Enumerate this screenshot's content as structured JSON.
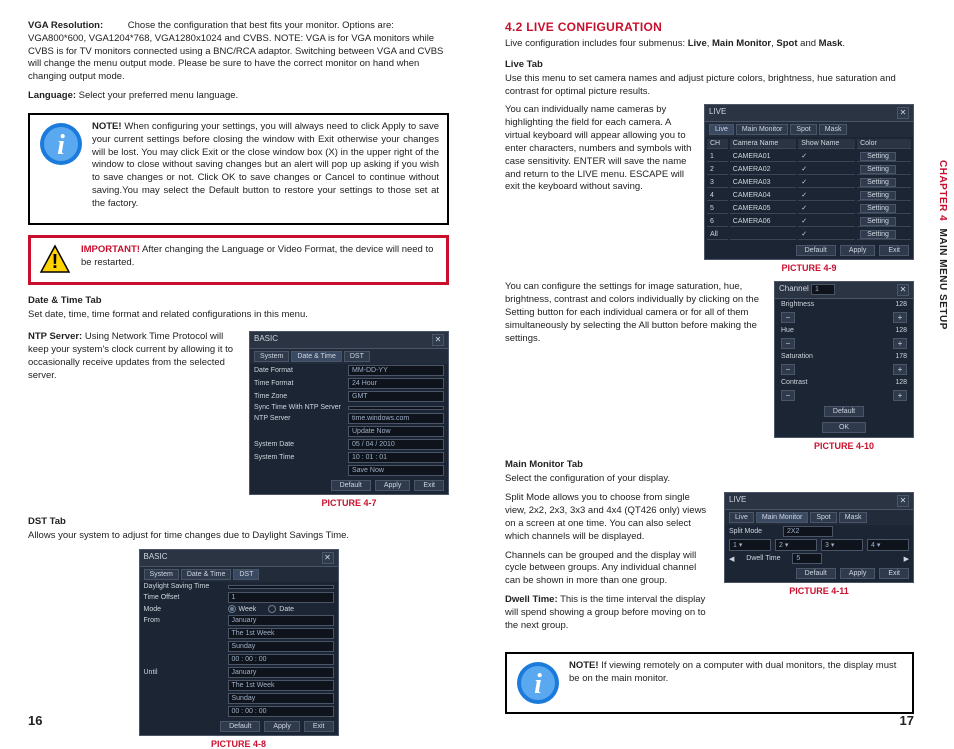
{
  "side": {
    "chapter": "CHAPTER 4",
    "title": "MAIN MENU SETUP"
  },
  "left": {
    "vga_head": "VGA Resolution:",
    "vga_body": " Chose the configuration that best fits your monitor. Options are: VGA800*600, VGA1204*768, VGA1280x1024 and CVBS. NOTE: VGA is for VGA monitors while CVBS is for TV monitors connected using a BNC/RCA adaptor. Switching between VGA and CVBS will change the menu output mode. Please be sure to have the correct monitor on hand when changing output mode.",
    "lang_head": "Language:",
    "lang_body": " Select your preferred menu language.",
    "note_head": "NOTE!",
    "note_body": " When configuring your settings, you will always need to click Apply to save your current settings before closing the window with Exit otherwise your changes will be lost. You may click Exit or the close window box (X) in the upper right of the window to close without saving changes but an alert will pop up asking if you wish to save changes or not. Click OK to save changes or Cancel to continue without saving.You may select the Default button to restore your settings to those set at the factory.",
    "important_head": "IMPORTANT!",
    "important_body": " After changing the Language or Video Format, the device will need to be restarted.",
    "dt_head": "Date & Time Tab",
    "dt_body": "Set date, time, time format and related configurations in this menu.",
    "ntp_head": "NTP Server:",
    "ntp_body": " Using Network Time Protocol will keep your system's clock current by allowing it to occasionally receive updates from the selected server.",
    "dst_head": "DST Tab",
    "dst_body": "Allows your system to adjust for time changes due to Daylight Savings Time.",
    "pic7": "PICTURE 4-7",
    "pic8": "PICTURE 4-8",
    "pagenum": "16",
    "ui47": {
      "title": "BASIC",
      "tab1": "System",
      "tab2": "Date & Time",
      "tab3": "DST",
      "rows": [
        [
          "Date Format",
          "MM-DD-YY"
        ],
        [
          "Time Format",
          "24 Hour"
        ],
        [
          "Time Zone",
          "GMT"
        ],
        [
          "Sync Time With NTP Server",
          ""
        ],
        [
          "NTP Server",
          "time.windows.com"
        ],
        [
          "",
          "Update Now"
        ],
        [
          "System Date",
          "05 / 04 / 2010"
        ],
        [
          "System Time",
          "10 : 01 : 01"
        ],
        [
          "",
          "Save Now"
        ]
      ],
      "btns": [
        "Default",
        "Apply",
        "Exit"
      ]
    },
    "ui48": {
      "title": "BASIC",
      "tab1": "System",
      "tab2": "Date & Time",
      "tab3": "DST",
      "rows": [
        [
          "Daylight Saving Time",
          ""
        ],
        [
          "Time Offset",
          "1"
        ],
        [
          "Mode",
          "Week",
          "Date"
        ],
        [
          "From",
          "January"
        ],
        [
          "",
          "The 1st Week"
        ],
        [
          "",
          "Sunday"
        ],
        [
          "",
          "00 : 00 : 00"
        ],
        [
          "Until",
          "January"
        ],
        [
          "",
          "The 1st Week"
        ],
        [
          "",
          "Sunday"
        ],
        [
          "",
          "00 : 00 : 00"
        ]
      ],
      "btns": [
        "Default",
        "Apply",
        "Exit"
      ]
    }
  },
  "right": {
    "head": "4.2 LIVE CONFIGURATION",
    "intro1": "Live configuration includes four submenus: ",
    "intro_live": "Live",
    "intro_mm": "Main Monitor",
    "intro_spot": "Spot",
    "intro_mask": "Mask",
    "intro_and": " and ",
    "intro_comma": ", ",
    "live_head": "Live Tab",
    "live_body": "Use this menu to set camera names and adjust picture colors, brightness, hue saturation and contrast for optimal picture results.",
    "para1": "You can individually name cameras by highlighting the field for each camera. A virtual keyboard will appear allowing you to enter characters, numbers and symbols with case sensitivity. ENTER will save the name and return to the LIVE menu. ESCAPE will exit the keyboard without saving.",
    "para2": "You can configure the settings for image saturation, hue, brightness, contrast and colors individually by clicking on the Setting button for each individual camera or for all of them simultaneously by selecting the All button before making the settings.",
    "mm_head": "Main Monitor Tab",
    "mm_body": "Select the configuration of your display.",
    "split_body": "Split Mode allows you to choose from single view, 2x2, 2x3, 3x3 and 4x4 (QT426 only) views on a screen at one time. You can also select which channels will be displayed.",
    "chan_body": "Channels can be grouped and the display will cycle between groups. Any individual channel can be shown in more than one group.",
    "dwell_head": "Dwell Time:",
    "dwell_body": " This is the time interval the display will spend showing a group before moving on to the next group.",
    "note2_head": "NOTE!",
    "note2_body": " If viewing remotely on a computer with dual monitors, the display must be on the main monitor.",
    "pic9": "PICTURE 4-9",
    "pic10": "PICTURE 4-10",
    "pic11": "PICTURE 4-11",
    "pagenum": "17",
    "ui49": {
      "title": "LIVE",
      "tab1": "Live",
      "tab2": "Main Monitor",
      "tab3": "Spot",
      "tab4": "Mask",
      "th": [
        "CH",
        "Camera Name",
        "Show Name",
        "Color"
      ],
      "rows": [
        [
          "1",
          "CAMERA01",
          "✓",
          "Setting"
        ],
        [
          "2",
          "CAMERA02",
          "✓",
          "Setting"
        ],
        [
          "3",
          "CAMERA03",
          "✓",
          "Setting"
        ],
        [
          "4",
          "CAMERA04",
          "✓",
          "Setting"
        ],
        [
          "5",
          "CAMERA05",
          "✓",
          "Setting"
        ],
        [
          "6",
          "CAMERA06",
          "✓",
          "Setting"
        ]
      ],
      "all_row": [
        "All",
        "",
        "✓",
        "Setting"
      ],
      "btns": [
        "Default",
        "Apply",
        "Exit"
      ]
    },
    "ui410": {
      "title": "Channel",
      "chval": "1",
      "items": [
        [
          "Brightness",
          "128"
        ],
        [
          "Hue",
          "128"
        ],
        [
          "Saturation",
          "178"
        ],
        [
          "Contrast",
          "128"
        ]
      ],
      "default": "Default",
      "ok": "OK"
    },
    "ui411": {
      "title": "LIVE",
      "tab1": "Live",
      "tab2": "Main Monitor",
      "tab3": "Spot",
      "tab4": "Mask",
      "splitlabel": "Split Mode",
      "splitval": "2X2",
      "chs": [
        "1",
        "2",
        "3",
        "4"
      ],
      "dwelllabel": "Dwell Time",
      "dwellval": "5",
      "btns": [
        "Default",
        "Apply",
        "Exit"
      ]
    }
  }
}
